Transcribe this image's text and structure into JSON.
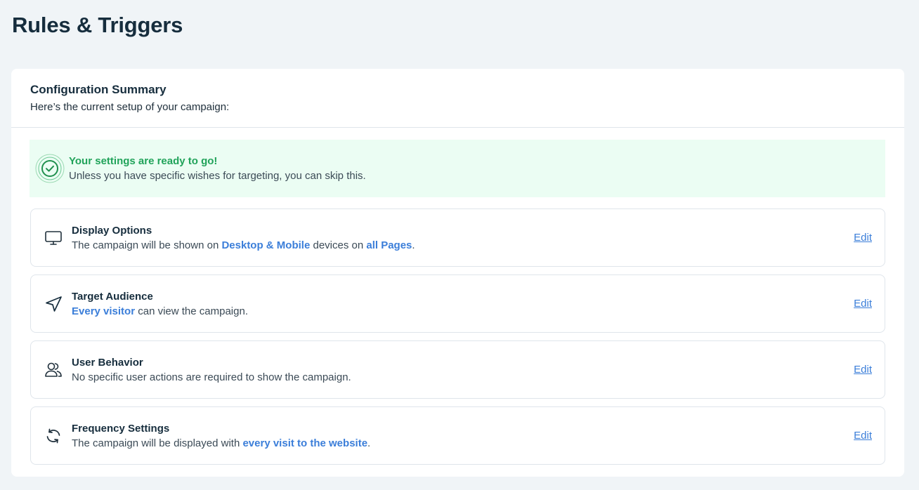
{
  "page": {
    "title": "Rules & Triggers"
  },
  "summary": {
    "title": "Configuration Summary",
    "subtitle": "Here’s the current setup of your campaign:"
  },
  "notice": {
    "icon": "check-circle-icon",
    "title": "Your settings are ready to go!",
    "text": "Unless you have specific wishes for targeting, you can skip this."
  },
  "rows": [
    {
      "icon": "monitor-icon",
      "title": "Display Options",
      "desc_parts": [
        "The campaign will be shown on ",
        "Desktop & Mobile",
        " devices on ",
        "all Pages",
        "."
      ],
      "edit_label": "Edit"
    },
    {
      "icon": "send-arrow-icon",
      "title": "Target Audience",
      "desc_parts": [
        "Every visitor",
        " can view the campaign."
      ],
      "edit_label": "Edit"
    },
    {
      "icon": "users-icon",
      "title": "User Behavior",
      "desc_parts": [
        "No specific user actions are required to show the campaign."
      ],
      "edit_label": "Edit"
    },
    {
      "icon": "refresh-icon",
      "title": "Frequency Settings",
      "desc_parts": [
        "The campaign will be displayed with ",
        "every visit to the website",
        "."
      ],
      "edit_label": "Edit"
    }
  ],
  "colors": {
    "accent": "#3b7ed9",
    "success": "#21a35a",
    "success_bg": "#ebfdf3",
    "page_bg": "#f0f4f7"
  }
}
